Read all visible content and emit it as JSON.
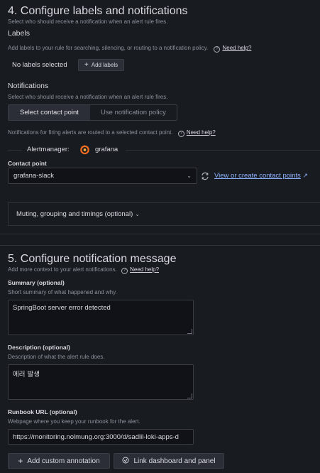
{
  "section4": {
    "title": "4. Configure labels and notifications",
    "subtitle": "Select who should receive a notification when an alert rule fires.",
    "labels": {
      "heading": "Labels",
      "description": "Add labels to your rule for searching, silencing, or routing to a notification policy.",
      "help": "Need help?",
      "empty_text": "No labels selected",
      "add_button": "Add labels"
    },
    "notifications": {
      "heading": "Notifications",
      "subtitle": "Select who should receive a notification when an alert rule fires.",
      "tabs": [
        "Select contact point",
        "Use notification policy"
      ],
      "active_tab": "Select contact point",
      "routing_note": "Notifications for firing alerts are routed to a selected contact point.",
      "help": "Need help?",
      "alertmanager_label": "Alertmanager:",
      "alertmanager_name": "grafana",
      "contact_point_label": "Contact point",
      "contact_point_value": "grafana-slack",
      "view_link": "View or create contact points",
      "muting_label": "Muting, grouping and timings (optional)"
    }
  },
  "section5": {
    "title": "5. Configure notification message",
    "subtitle": "Add more context to your alert notifications.",
    "help": "Need help?",
    "summary": {
      "label": "Summary (optional)",
      "description": "Short summary of what happened and why.",
      "value": "SpringBoot server error detected"
    },
    "description": {
      "label": "Description (optional)",
      "description": "Description of what the alert rule does.",
      "value": "에러 발생"
    },
    "runbook": {
      "label": "Runbook URL (optional)",
      "description": "Webpage where you keep your runbook for the alert.",
      "value": "https://monitoring.nolmung.org:3000/d/sadlil-loki-apps-d"
    },
    "buttons": {
      "add_annotation": "Add custom annotation",
      "link_dashboard": "Link dashboard and panel"
    }
  },
  "colors": {
    "background": "#181b1f",
    "link": "#8eb2ff",
    "grafana_orange": "#f26b21"
  }
}
